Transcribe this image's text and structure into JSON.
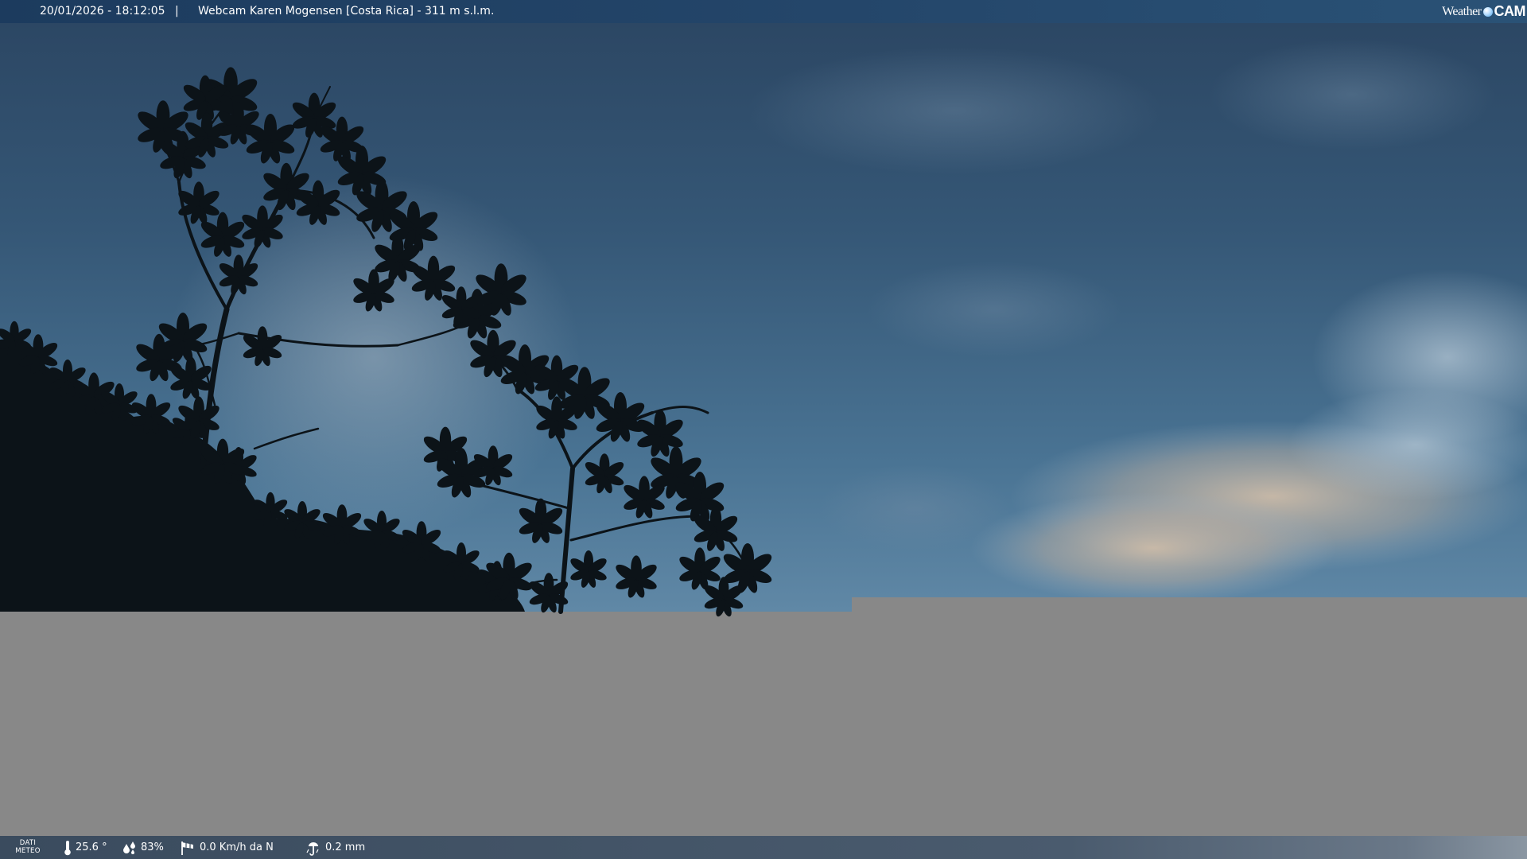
{
  "header": {
    "timestamp": "20/01/2026 - 18:12:05",
    "separator": "|",
    "title": "Webcam Karen Mogensen [Costa Rica]  - 311 m s.l.m.",
    "logo": {
      "part1": "Weather",
      "part2": "CAM"
    }
  },
  "footer": {
    "label_line1": "DATI",
    "label_line2": "METEO",
    "temperature": "25.6 °",
    "humidity": "83%",
    "wind": "0.0 Km/h da N",
    "rain": "0.2 mm"
  },
  "icons": {
    "temperature": "thermometer-icon",
    "humidity": "humidity-drops-icon",
    "wind": "wind-windsock-icon",
    "rain": "rain-gauge-icon",
    "logo_dot": "globe-icon"
  },
  "colors": {
    "sky_top": "#2c4764",
    "sky_mid": "#3d6282",
    "sky_bottom": "#5d86a4",
    "foliage": "#0c1318",
    "gray_area": "#888888",
    "cloud_warm": "#c8b7a4"
  }
}
